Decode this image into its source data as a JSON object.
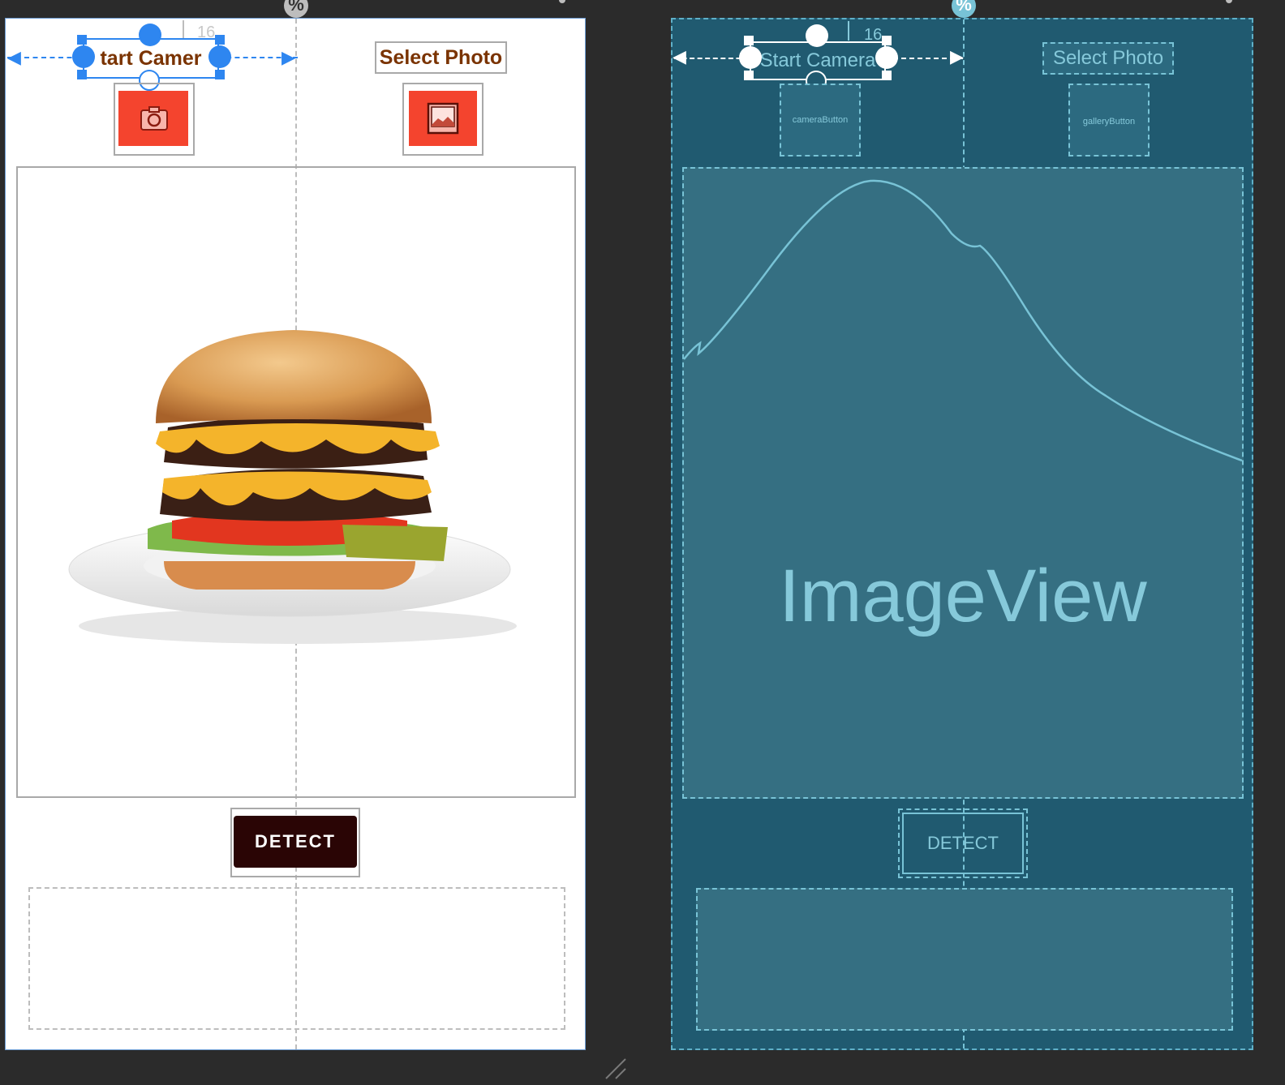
{
  "design_view": {
    "start_camera_label": "tart Camer",
    "select_photo_label": "Select Photo",
    "camera_icon": "camera-icon",
    "gallery_icon": "image-icon",
    "detect_label": "DETECT",
    "margin_badge": "16",
    "percent_guideline": "%"
  },
  "blueprint_view": {
    "start_camera_label": "Start Camera",
    "select_photo_label": "Select Photo",
    "camera_button_id": "cameraButton",
    "gallery_button_id": "galleryButton",
    "imageview_label": "ImageView",
    "detect_label": "DETECT",
    "margin_badge": "16",
    "percent_guideline": "%"
  },
  "colors": {
    "design_background": "#ffffff",
    "blueprint_background": "#205a70",
    "selection_blue": "#2e86f0",
    "button_red": "#f4442e",
    "detect_button": "#2a0505",
    "label_brown": "#7a3300"
  }
}
